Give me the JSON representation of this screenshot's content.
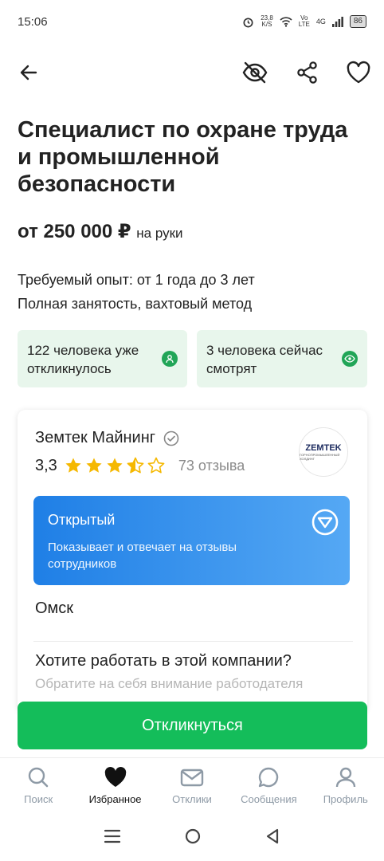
{
  "status_bar": {
    "time": "15:06",
    "speed": "23,8",
    "speed_unit": "K/S",
    "net1": "Vo",
    "net2": "LTE",
    "net3": "4G",
    "battery": "86"
  },
  "vacancy": {
    "title": "Специалист по охране труда и промышленной безопасности",
    "salary": "от 250 000 ₽",
    "salary_note": "на руки",
    "experience": "Требуемый опыт: от 1 года до 3 лет",
    "employment": "Полная занятость, вахтовый метод"
  },
  "stats": {
    "responded": "122 человека уже откликнулось",
    "watching": "3 человека сейчас смотрят"
  },
  "company": {
    "name": "Земтек Майнинг",
    "rating": "3,3",
    "stars": 3.5,
    "reviews": "73 отзыва",
    "logo_text": "ZEMTEK",
    "logo_tag": "ГОРНОПРОМЫШЛЕННЫЙ ХОЛДИНГ",
    "open_title": "Открытый",
    "open_text": "Показывает и отвечает на отзывы сотрудников",
    "city": "Омск",
    "want_title": "Хотите работать в этой компании?",
    "want_sub": "Обратите на себя внимание работодателя"
  },
  "apply_label": "Откликнуться",
  "nav": {
    "search": "Поиск",
    "favorites": "Избранное",
    "responses": "Отклики",
    "messages": "Сообщения",
    "profile": "Профиль"
  },
  "colors": {
    "accent": "#14bd5a",
    "banner": "#1f7fe6",
    "star": "#f5b800"
  }
}
